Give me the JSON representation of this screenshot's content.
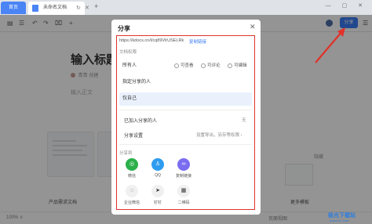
{
  "tabs": {
    "home_label": "首页",
    "doc_label": "未命名文档"
  },
  "toolbar": {
    "share_label": "分享"
  },
  "document": {
    "title": "输入标题",
    "author": "青青",
    "meta_suffix": "创建",
    "body_placeholder": "输入正文",
    "recommend_label": "隐藏",
    "templates": [
      {
        "label": "产品需求文档"
      },
      {
        "label": ""
      }
    ],
    "more_label": "更多模板",
    "zoom_label": "100% ∨",
    "mode_label": "页面视图"
  },
  "dialog": {
    "title": "分享",
    "link_url": "https://kdocs.cn/l/cq89VlrUSELRk",
    "copy_link_label": "复制链接",
    "permission_title": "文档权限",
    "options": [
      {
        "label": "所有人",
        "selected": false
      },
      {
        "label": "指定分享的人",
        "selected": false
      },
      {
        "label": "仅自己",
        "selected": true
      }
    ],
    "radio_options": [
      "可查看",
      "可评论",
      "可编辑"
    ],
    "added_people_label": "已加入分享的人",
    "added_people_value": "无",
    "share_settings_label": "分享设置",
    "share_settings_value": "设置导出，另存等权限 ›",
    "share_to_label": "分享到",
    "apps": [
      {
        "label": "微信",
        "icon": "wechat-icon",
        "color": "#2bb04b",
        "glyph": "◎"
      },
      {
        "label": "QQ",
        "icon": "qq-icon",
        "color": "#2d9cf0",
        "glyph": "♙"
      },
      {
        "label": "复制链接",
        "icon": "link-icon",
        "color": "#7a6df0",
        "glyph": "∞"
      },
      {
        "label": "企业微信",
        "icon": "wecom-icon",
        "color": "#f0f0f0",
        "glyph": "◌"
      },
      {
        "label": "钉钉",
        "icon": "dingtalk-icon",
        "color": "#f0f0f0",
        "glyph": "➤"
      },
      {
        "label": "二维码",
        "icon": "qrcode-icon",
        "color": "#f0f0f0",
        "glyph": "▦"
      }
    ]
  },
  "watermark": {
    "line1": "极光下载站",
    "line2": "www.xz7.com"
  }
}
